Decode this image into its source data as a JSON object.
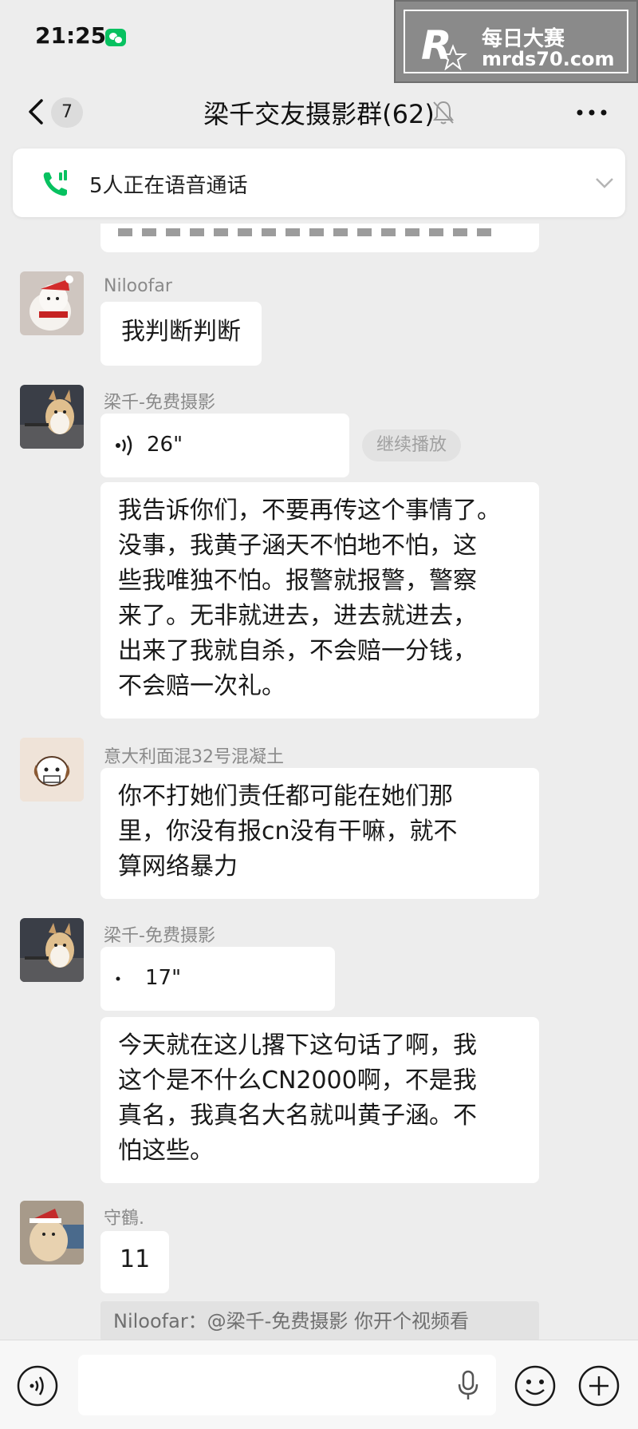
{
  "status_bar": {
    "time": "21:25"
  },
  "watermark": {
    "brand": "每日大赛",
    "url": "mrds70.com",
    "logo_letter": "R"
  },
  "nav": {
    "unread_count": "7",
    "title": "梁千交友摄影群(62)"
  },
  "call_banner": {
    "text": "5人正在语音通话"
  },
  "messages": [
    {
      "sender": "Niloofar",
      "type": "text",
      "text": "我判断判断"
    },
    {
      "sender": "梁千-免费摄影",
      "type": "voice",
      "duration": "26\"",
      "action": "继续播放"
    },
    {
      "type": "text",
      "lines": [
        "我告诉你们，不要再传这个事情了。",
        "没事，我黄子涵天不怕地不怕，这",
        "些我唯独不怕。报警就报警，警察",
        "来了。无非就进去，进去就进去，",
        "出来了我就自杀，不会赔一分钱，",
        "不会赔一次礼。"
      ]
    },
    {
      "sender": "意大利面混32号混凝土",
      "type": "text",
      "lines": [
        "你不打她们责任都可能在她们那",
        "里，你没有报cn没有干嘛，就不",
        "算网络暴力"
      ]
    },
    {
      "sender": "梁千-免费摄影",
      "type": "voice",
      "duration": "17\""
    },
    {
      "type": "text",
      "lines": [
        "今天就在这儿撂下这句话了啊，我",
        "这个是不什么CN2000啊，不是我",
        "真名，我真名大名就叫黄子涵。不",
        "怕这些。"
      ]
    },
    {
      "sender": "守鶴.",
      "type": "text",
      "text": "11"
    }
  ],
  "quote": {
    "text": "Niloofar：@梁千-免费摄影 你开个视频看"
  },
  "input": {
    "value": ""
  },
  "colors": {
    "accent": "#07c160",
    "background": "#ededed",
    "bubble": "#ffffff"
  }
}
